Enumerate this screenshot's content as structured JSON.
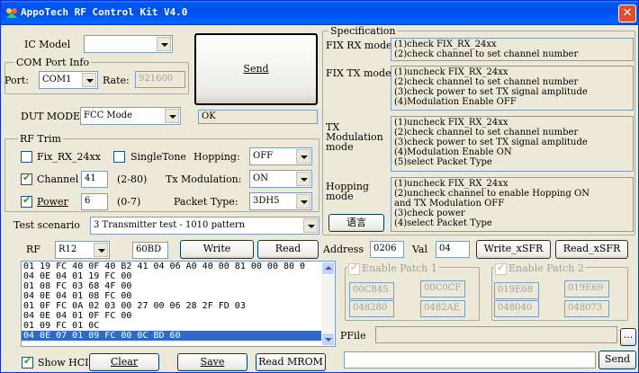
{
  "window": {
    "title": "AppoTech RF Control Kit V4.0"
  },
  "ic_model": {
    "label": "IC Model",
    "value": ""
  },
  "com_port": {
    "group_title": "COM Port Info",
    "port_label": "Port:",
    "port_value": "COM1",
    "rate_label": "Rate:",
    "rate_value": "921600"
  },
  "send_button": "Send",
  "dut_mode": {
    "label": "DUT MODE",
    "value": "FCC Mode",
    "status": "OK"
  },
  "rf_trim": {
    "group_title": "RF Trim",
    "fix_rx_label": "Fix_RX_24xx",
    "fix_rx_checked": false,
    "single_tone_label": "SingleTone",
    "single_tone_checked": false,
    "hopping_label": "Hopping:",
    "hopping_value": "OFF",
    "channel_label": "Channel",
    "channel_checked": true,
    "channel_value": "41",
    "channel_range": "(2-80)",
    "tx_mod_label": "Tx Modulation:",
    "tx_mod_value": "ON",
    "power_label": "Power",
    "power_checked": true,
    "power_value": "6",
    "power_range": "(0-7)",
    "packet_type_label": "Packet Type:",
    "packet_type_value": "3DH5"
  },
  "test_scenario": {
    "label": "Test scenario",
    "value": "3 Transmitter test - 1010 pattern"
  },
  "specification": {
    "group_title": "Specification",
    "sections": [
      {
        "label_lines": [
          "FIX RX mode"
        ],
        "lines": [
          "(1)check FIX_RX_24xx",
          "(2)check channel to set channel number"
        ]
      },
      {
        "label_lines": [
          "FIX TX mode"
        ],
        "lines": [
          "(1)uncheck FIX_RX_24xx",
          "(2)check channel to set channel number",
          "(3)check power to set TX signal amplitude",
          "(4)Modulation Enable OFF"
        ]
      },
      {
        "label_lines": [
          "TX",
          "Modulation",
          "mode"
        ],
        "lines": [
          "(1)uncheck FIX_RX_24xx",
          "(2)check channel to set channel number",
          "(3)check power to set TX signal amplitude",
          "(4)Modulation Enable ON",
          "(5)select Packet Type"
        ]
      },
      {
        "label_lines": [
          "Hopping",
          "mode"
        ],
        "lines": [
          "(1)uncheck FIX_RX_24xx",
          "(2)uncheck channel to enable Hopping ON",
          "and TX Modulation OFF",
          "(3)check power",
          "(4)select Packet Type"
        ]
      }
    ],
    "language_button": "语言"
  },
  "rf_register": {
    "label": "RF",
    "reg_value": "R12",
    "data_value": "60BD",
    "write_button": "Write",
    "read_button": "Read"
  },
  "sfr": {
    "address_label": "Address",
    "address_value": "0206",
    "val_label": "Val",
    "val_value": "04",
    "write_button": "Write_xSFR",
    "read_button": "Read_xSFR"
  },
  "patch1": {
    "label": "Enable Patch 1",
    "checked": true,
    "fields": [
      "00C845",
      "00C0CF",
      "048280",
      "0482AE"
    ]
  },
  "patch2": {
    "label": "Enable Patch 2",
    "checked": true,
    "fields": [
      "019E68",
      "019E69",
      "048040",
      "048073"
    ]
  },
  "pfile": {
    "label": "PFile",
    "value": "",
    "browse_button": "..."
  },
  "hci_log": {
    "lines": [
      "01 19 FC 40 0F 40 B2 41 04 06 A0 40 00 81 00 00 80 0",
      "04 0E 04 01 19 FC 00",
      "01 08 FC 03 68 4F 00",
      "04 0E 04 01 08 FC 00",
      "01 0F FC 0A 02 03 00 27 00 06 28 2F FD 03",
      "04 0E 04 01 0F FC 00",
      "01 09 FC 01 0C",
      "04 0E 07 01 09 FC 00 0C BD 60"
    ],
    "selected_index": 7
  },
  "bottom_bar": {
    "show_hci_label": "Show HCI",
    "show_hci_checked": true,
    "clear_button": "Clear",
    "save_button": "Save",
    "read_mrom_button": "Read MROM",
    "send_input": "",
    "send_button": "Send"
  }
}
